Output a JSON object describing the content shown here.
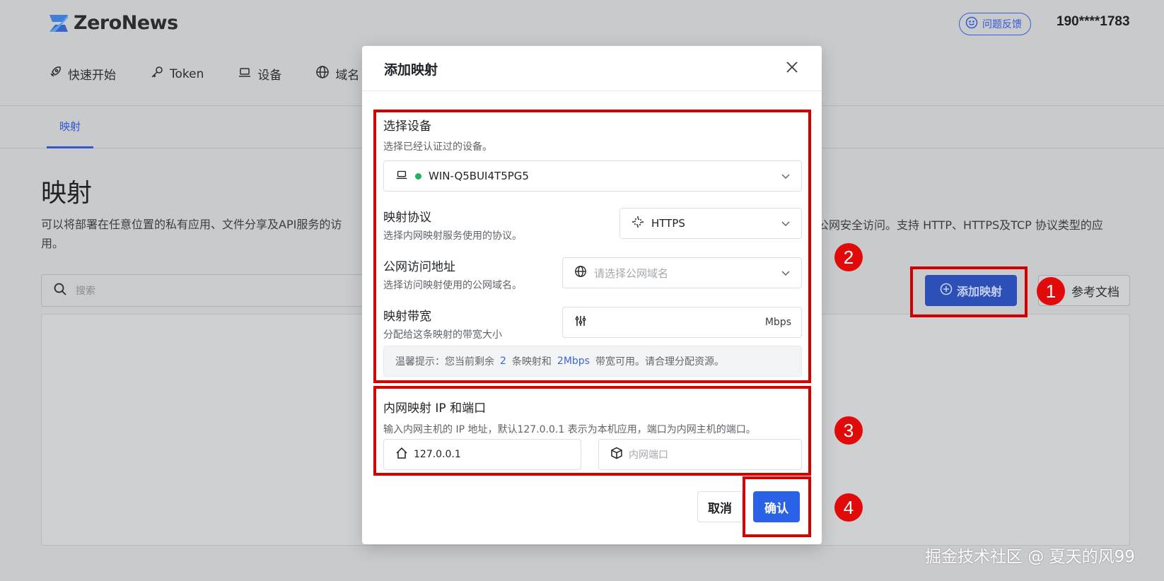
{
  "app": {
    "logo_text": "ZeroNews",
    "feedback_label": "问题反馈",
    "user_phone": "190****1783"
  },
  "nav": {
    "items": [
      {
        "label": "快速开始",
        "icon": "rocket-icon"
      },
      {
        "label": "Token",
        "icon": "key-icon"
      },
      {
        "label": "设备",
        "icon": "laptop-icon"
      },
      {
        "label": "域名",
        "icon": "globe-icon"
      }
    ]
  },
  "subnav": {
    "active_tab": "映射"
  },
  "main": {
    "title": "映射",
    "description_left": "可以将部署在任意位置的私有应用、文件分享及API服务的访",
    "description_right": "公网安全访问。支持 HTTP、HTTPS及TCP 协议类型的应",
    "description_wrap": "用。",
    "search_placeholder": "搜索",
    "add_button": "添加映射",
    "docs_button": "参考文档"
  },
  "modal": {
    "title": "添加映射",
    "device": {
      "label": "选择设备",
      "help": "选择已经认证过的设备。",
      "value": "WIN-Q5BUI4T5PG5"
    },
    "protocol": {
      "label": "映射协议",
      "help": "选择内网映射服务使用的协议。",
      "value": "HTTPS"
    },
    "domain": {
      "label": "公网访问地址",
      "help": "选择访问映射使用的公网域名。",
      "placeholder": "请选择公网域名"
    },
    "bandwidth": {
      "label": "映射带宽",
      "help": "分配给这条映射的带宽大小",
      "unit": "Mbps"
    },
    "tip": {
      "prefix": "温馨提示：您当前剩余",
      "count": "2",
      "middle": "条映射和",
      "bandwidth": "2Mbps",
      "suffix": "带宽可用。请合理分配资源。"
    },
    "internal": {
      "label": "内网映射 IP 和端口",
      "help": "输入内网主机的 IP 地址，默认127.0.0.1 表示为本机应用，端口为内网主机的端口。",
      "ip_value": "127.0.0.1",
      "port_placeholder": "内网端口"
    },
    "cancel_label": "取消",
    "confirm_label": "确认"
  },
  "annotations": {
    "markers": [
      "1",
      "2",
      "3",
      "4"
    ],
    "color": "#e20b0b"
  },
  "watermark": "掘金技术社区 @ 夏天的风99",
  "colors": {
    "primary": "#2a63e8",
    "status_online": "#22b35f",
    "highlight": "#3a67d6"
  }
}
